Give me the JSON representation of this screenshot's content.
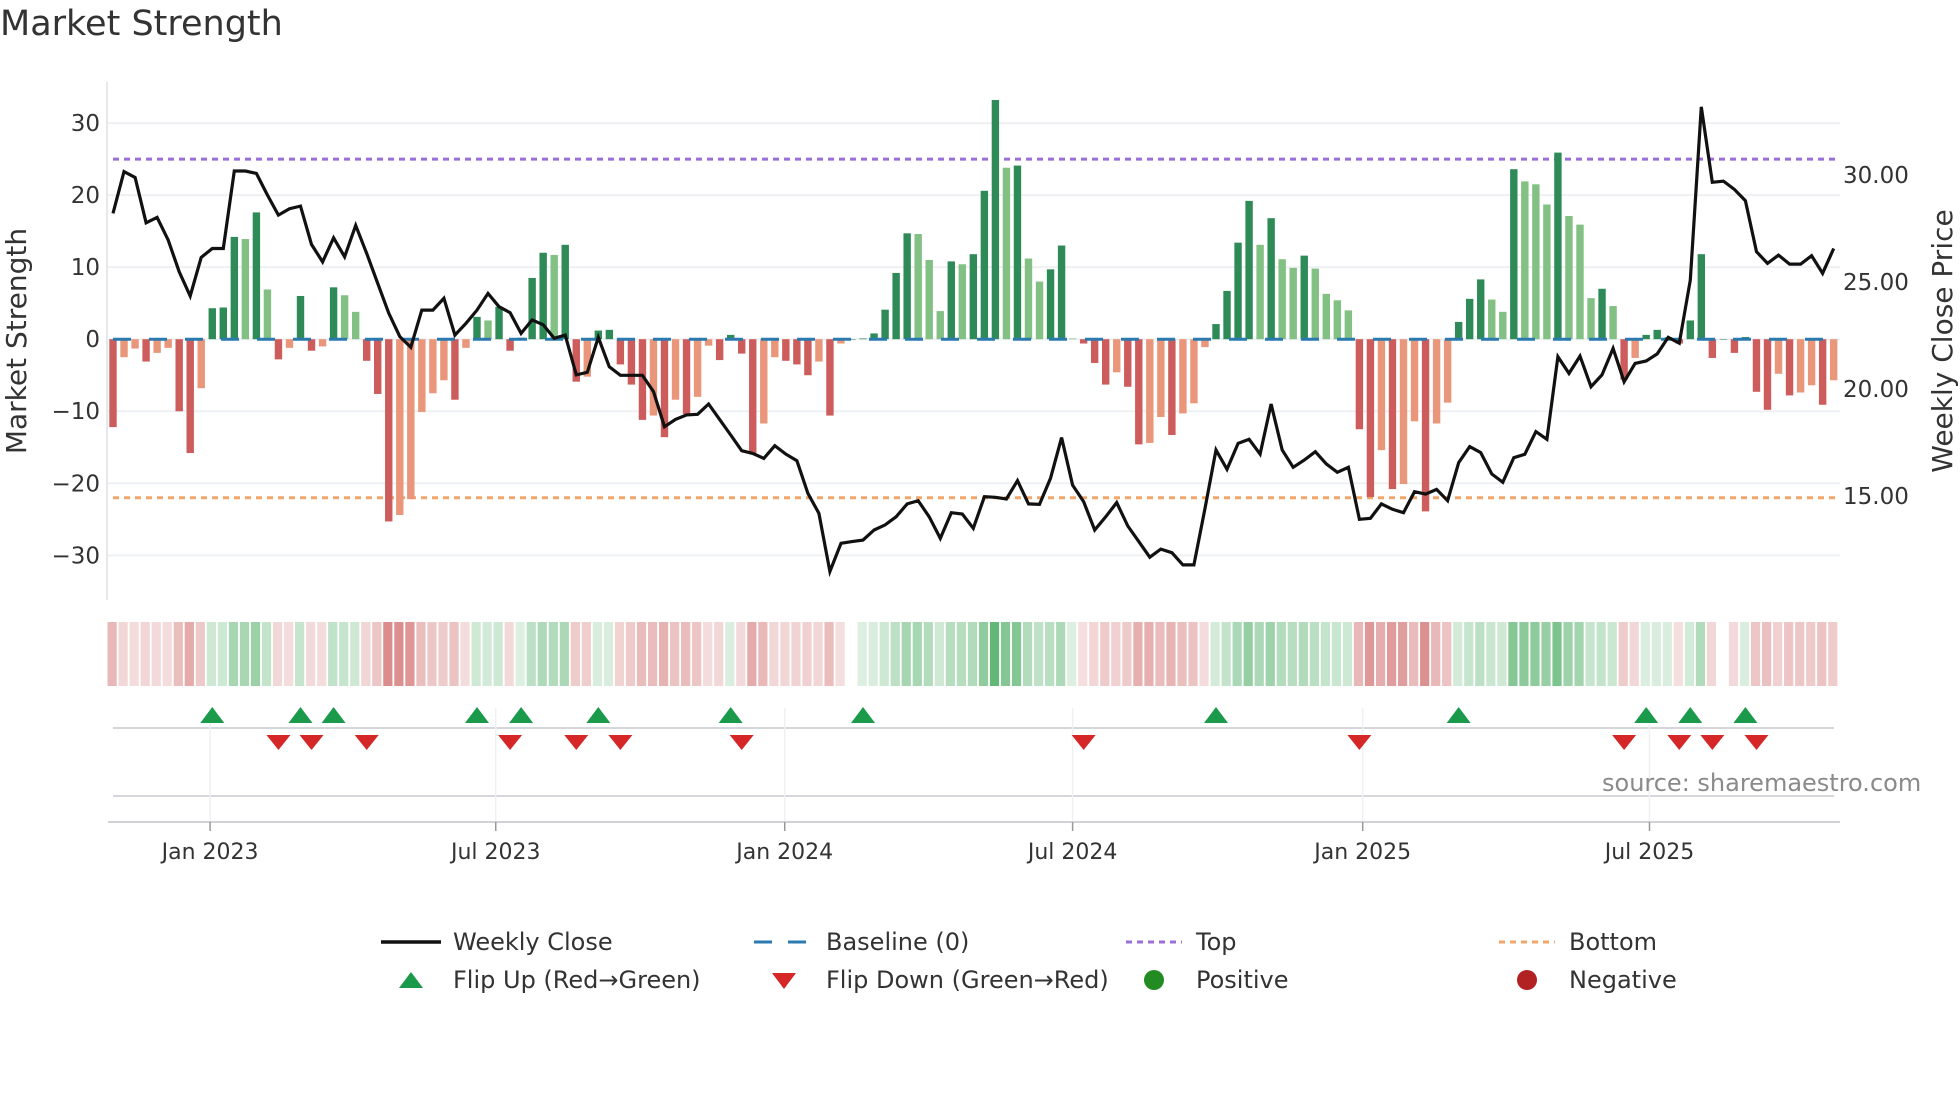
{
  "chart_data": {
    "type": "bar",
    "title": "Market Strength",
    "ylabel": "Market Strength",
    "ylabel_right": "Weekly Close Price",
    "source": "source: sharemaestro.com",
    "x_unit": "week index",
    "x_ticks": [
      {
        "label": "Jan 2023",
        "week": 8.8
      },
      {
        "label": "Jul 2023",
        "week": 34.7
      },
      {
        "label": "Jan 2024",
        "week": 60.9
      },
      {
        "label": "Jul 2024",
        "week": 87.0
      },
      {
        "label": "Jan 2025",
        "week": 113.3
      },
      {
        "label": "Jul 2025",
        "week": 139.3
      }
    ],
    "ylim": [
      -36.2,
      35.7
    ],
    "y_ticks": [
      {
        "v": 30,
        "label": "30"
      },
      {
        "v": 20,
        "label": "20"
      },
      {
        "v": 10,
        "label": "10"
      },
      {
        "v": 0,
        "label": "0"
      },
      {
        "v": -10,
        "label": "−10"
      },
      {
        "v": -20,
        "label": "−20"
      },
      {
        "v": -30,
        "label": "−30"
      }
    ],
    "ylim_right": [
      10.14,
      34.35
    ],
    "y_ticks_right": [
      {
        "v": 30,
        "label": "30.00"
      },
      {
        "v": 25,
        "label": "25.00"
      },
      {
        "v": 20,
        "label": "20.00"
      },
      {
        "v": 15,
        "label": "15.00"
      }
    ],
    "top_level": 25,
    "bottom_level": -22,
    "grid": true,
    "strength": [
      -12.2,
      -2.5,
      -1.3,
      -3.1,
      -1.9,
      -1.2,
      -10,
      -15.8,
      -6.8,
      4.3,
      4.4,
      14.2,
      13.9,
      17.6,
      6.9,
      -2.8,
      -1.2,
      6.0,
      -1.6,
      -1.0,
      7.2,
      6.1,
      3.8,
      -3.0,
      -7.6,
      -25.3,
      -24.4,
      -22.2,
      -10.1,
      -7.5,
      -5.7,
      -8.4,
      -1.2,
      3.1,
      2.6,
      4.5,
      -1.6,
      0.2,
      8.5,
      12.0,
      11.7,
      13.1,
      -5.9,
      -5.2,
      1.2,
      1.3,
      -3.5,
      -6.3,
      -11.2,
      -10.6,
      -13.6,
      -8.4,
      -10.4,
      -8.0,
      -0.9,
      -2.9,
      0.6,
      -2.0,
      -15.9,
      -11.7,
      -2.5,
      -3.0,
      -3.5,
      -5.0,
      -3.1,
      -10.6,
      -0.6,
      0,
      0.1,
      0.8,
      4.1,
      9.2,
      14.7,
      14.6,
      11.0,
      3.9,
      10.8,
      10.4,
      11.8,
      20.6,
      33.2,
      23.8,
      24.1,
      11.2,
      8.0,
      9.7,
      13.0,
      0.1,
      -0.6,
      -3.3,
      -6.3,
      -4.6,
      -6.6,
      -14.6,
      -14.4,
      -10.8,
      -13.3,
      -10.3,
      -8.9,
      -1.1,
      2.1,
      6.7,
      13.4,
      19.2,
      13.1,
      16.8,
      11.1,
      9.9,
      11.6,
      9.8,
      6.3,
      5.4,
      4.0,
      -12.5,
      -21.9,
      -15.4,
      -20.8,
      -20.1,
      -11.4,
      -23.9,
      -11.7,
      -8.8,
      2.4,
      5.6,
      8.3,
      5.5,
      3.8,
      23.6,
      21.9,
      21.5,
      18.7,
      25.9,
      17.1,
      15.9,
      5.7,
      7.0,
      4.6,
      -5.6,
      -2.6,
      0.6,
      1.3,
      0.3,
      -0.6,
      2.6,
      11.8,
      -2.6,
      0,
      -1.9,
      0.3,
      -7.3,
      -9.8,
      -4.8,
      -7.8,
      -7.4,
      -6.4,
      -9.1,
      -5.7
    ],
    "close": [
      28.21,
      30.16,
      29.89,
      27.77,
      28.02,
      26.96,
      25.48,
      24.35,
      26.15,
      26.57,
      26.57,
      30.19,
      30.19,
      30.08,
      29.07,
      28.13,
      28.43,
      28.55,
      26.76,
      25.94,
      27.07,
      26.18,
      27.65,
      26.34,
      24.94,
      23.54,
      22.45,
      21.95,
      23.69,
      23.69,
      24.24,
      22.52,
      23.07,
      23.69,
      24.47,
      23.85,
      23.57,
      22.6,
      23.23,
      23.0,
      22.37,
      22.52,
      20.66,
      20.78,
      22.42,
      21.04,
      20.64,
      20.64,
      20.64,
      19.88,
      18.24,
      18.58,
      18.79,
      18.82,
      19.3,
      18.58,
      17.85,
      17.12,
      16.99,
      16.76,
      17.35,
      16.96,
      16.65,
      15.12,
      14.19,
      11.47,
      12.79,
      12.87,
      12.94,
      13.41,
      13.65,
      14.03,
      14.63,
      14.78,
      14.03,
      13.02,
      14.22,
      14.16,
      13.49,
      14.97,
      14.94,
      14.86,
      15.72,
      14.63,
      14.61,
      15.83,
      17.73,
      15.51,
      14.74,
      13.41,
      14.03,
      14.69,
      13.6,
      12.87,
      12.14,
      12.52,
      12.35,
      11.78,
      11.78,
      14.42,
      17.15,
      16.25,
      17.46,
      17.65,
      16.96,
      19.3,
      17.15,
      16.34,
      16.68,
      17.07,
      16.5,
      16.11,
      16.34,
      13.91,
      13.96,
      14.63,
      14.38,
      14.22,
      15.2,
      15.09,
      15.31,
      14.78,
      16.56,
      17.31,
      17.03,
      16.03,
      15.64,
      16.79,
      16.95,
      18.01,
      17.65,
      21.51,
      20.73,
      21.54,
      20.11,
      20.66,
      21.9,
      20.34,
      21.2,
      21.31,
      21.64,
      22.42,
      22.14,
      25.09,
      33.19,
      29.66,
      29.72,
      29.33,
      28.8,
      26.42,
      25.87,
      26.26,
      25.84,
      25.84,
      26.23,
      25.41,
      26.57
    ],
    "flip_up_weeks": [
      9,
      17,
      20,
      33,
      37,
      44,
      56,
      68,
      100,
      122,
      139,
      143,
      148
    ],
    "flip_down_weeks": [
      15,
      18,
      23,
      36,
      42,
      46,
      57,
      88,
      113,
      137,
      142,
      145,
      149
    ],
    "legend": {
      "weekly_close": "Weekly Close",
      "baseline": "Baseline (0)",
      "top": "Top",
      "bottom": "Bottom",
      "flip_up": "Flip Up (Red→Green)",
      "flip_down": "Flip Down (Green→Red)",
      "positive": "Positive",
      "negative": "Negative"
    },
    "colors": {
      "pos_strong": "#2e8b57",
      "pos_weak": "#82c084",
      "neg_strong": "#cd5c5c",
      "neg_weak": "#e9967a",
      "baseline": "#2a7ab0",
      "top": "#9a6fd8",
      "bottom": "#f2a66a",
      "line": "#111111",
      "flip_up": "#1a9a4a",
      "flip_down": "#d62728",
      "positive": "#228b22",
      "negative": "#b22222"
    }
  }
}
